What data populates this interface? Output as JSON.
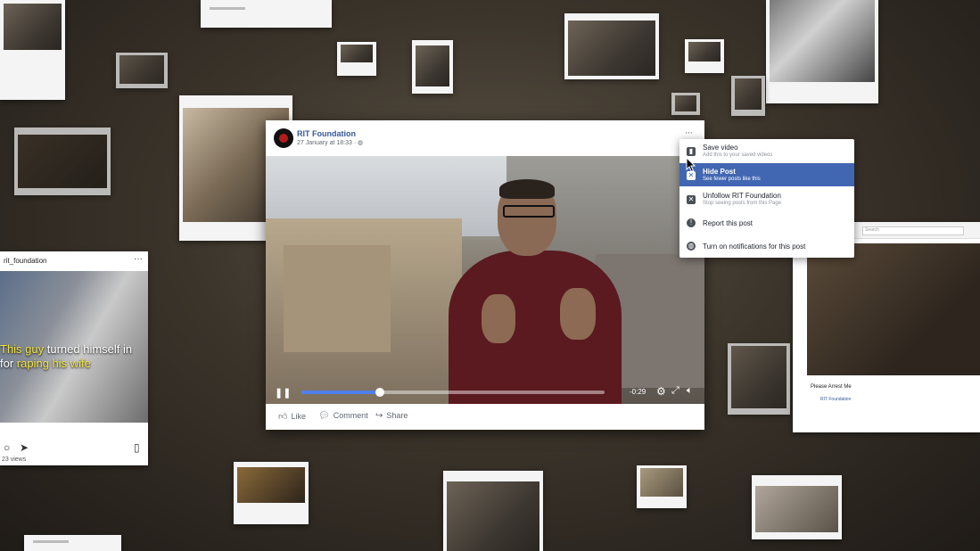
{
  "post": {
    "page_name": "RIT Foundation",
    "timestamp": "27 January at 18:33 ·",
    "more_label": "···",
    "video": {
      "progress": 0.26,
      "remaining": "-0:29"
    },
    "actions": {
      "like": "Like",
      "comment": "Comment",
      "share": "Share"
    }
  },
  "menu": {
    "items": [
      {
        "title": "Save video",
        "subtitle": "Add this to your saved videos",
        "icon": "bookmark-icon"
      },
      {
        "title": "Hide Post",
        "subtitle": "See fewer posts like this",
        "icon": "hide-icon",
        "active": true
      },
      {
        "title": "Unfollow RIT Foundation",
        "subtitle": "Stop seeing posts from this Page",
        "icon": "unfollow-icon"
      },
      {
        "title": "Report this post",
        "subtitle": "",
        "icon": "report-icon"
      },
      {
        "title": "Turn on notifications for this post",
        "subtitle": "",
        "icon": "globe-icon"
      }
    ],
    "active_color": "#4267b2"
  },
  "instagram_card": {
    "username": "rit_foundation",
    "more_label": "···",
    "caption_plain_1": "This guy",
    "caption_plain_2": " turned himself in",
    "caption_plain_3": "for ",
    "caption_highlight": "raping his wife",
    "views": "23 views"
  },
  "right_card": {
    "search_placeholder": "Search",
    "post_title": "Please Arrest Me",
    "page_name": "RIT Foundation"
  },
  "colors": {
    "link": "#365899",
    "caption_highlight": "#f4e53a"
  }
}
